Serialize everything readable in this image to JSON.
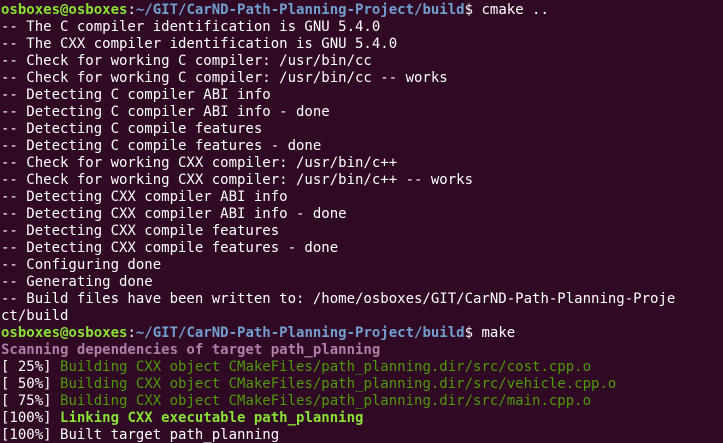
{
  "colors": {
    "background": "#300a24",
    "user_host": "#8ae234",
    "path": "#729fcf",
    "text": "#ffffff",
    "scan": "#ad7fa8",
    "build": "#4e9a06",
    "link": "#8ae234"
  },
  "prompt1": {
    "user_host": "osboxes@osboxes",
    "sep1": ":",
    "path": "~/GIT/CarND-Path-Planning-Project/build",
    "dollar": "$",
    "command": " cmake .."
  },
  "cmake_output": [
    "-- The C compiler identification is GNU 5.4.0",
    "-- The CXX compiler identification is GNU 5.4.0",
    "-- Check for working C compiler: /usr/bin/cc",
    "-- Check for working C compiler: /usr/bin/cc -- works",
    "-- Detecting C compiler ABI info",
    "-- Detecting C compiler ABI info - done",
    "-- Detecting C compile features",
    "-- Detecting C compile features - done",
    "-- Check for working CXX compiler: /usr/bin/c++",
    "-- Check for working CXX compiler: /usr/bin/c++ -- works",
    "-- Detecting CXX compiler ABI info",
    "-- Detecting CXX compiler ABI info - done",
    "-- Detecting CXX compile features",
    "-- Detecting CXX compile features - done",
    "-- Configuring done",
    "-- Generating done",
    "-- Build files have been written to: /home/osboxes/GIT/CarND-Path-Planning-Proje",
    "ct/build"
  ],
  "prompt2": {
    "user_host": "osboxes@osboxes",
    "sep1": ":",
    "path": "~/GIT/CarND-Path-Planning-Project/build",
    "dollar": "$",
    "command": " make"
  },
  "make_output": {
    "scanning": "Scanning dependencies of target path_planning",
    "steps": [
      {
        "pct": "[ 25%] ",
        "text": "Building CXX object CMakeFiles/path_planning.dir/src/cost.cpp.o"
      },
      {
        "pct": "[ 50%] ",
        "text": "Building CXX object CMakeFiles/path_planning.dir/src/vehicle.cpp.o"
      },
      {
        "pct": "[ 75%] ",
        "text": "Building CXX object CMakeFiles/path_planning.dir/src/main.cpp.o"
      }
    ],
    "linking": {
      "pct": "[100%] ",
      "text": "Linking CXX executable path_planning"
    },
    "built": {
      "pct": "[100%] ",
      "text": "Built target path_planning"
    }
  }
}
